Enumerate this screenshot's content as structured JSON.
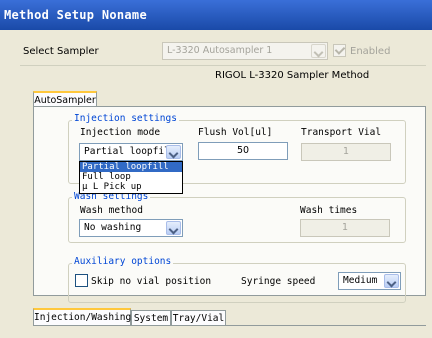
{
  "window": {
    "title": "Method Setup Noname"
  },
  "sampler": {
    "label": "Select Sampler",
    "value": "L-3320 Autosampler 1",
    "enabled_label": "Enabled",
    "enabled_checked": true,
    "method_title": "RIGOL L-3320 Sampler Method"
  },
  "top_tab": {
    "label": "AutoSampler"
  },
  "injection": {
    "legend": "Injection settings",
    "mode_label": "Injection mode",
    "mode_value": "Partial loopfill",
    "mode_options": [
      "Partial loopfill",
      "Full loop",
      "μ L Pick up"
    ],
    "flush_label": "Flush Vol[ul]",
    "flush_value": "50",
    "transport_label": "Transport Vial",
    "transport_value": "1"
  },
  "wash": {
    "legend": "Wash settings",
    "method_label": "Wash method",
    "method_value": "No washing",
    "times_label": "Wash times",
    "times_value": "1"
  },
  "aux": {
    "legend": "Auxiliary options",
    "skip_label": "Skip no vial position",
    "skip_checked": false,
    "syringe_label": "Syringe speed",
    "syringe_value": "Medium"
  },
  "bottom_tabs": [
    "Injection/Washing",
    "System",
    "Tray/Vial"
  ]
}
